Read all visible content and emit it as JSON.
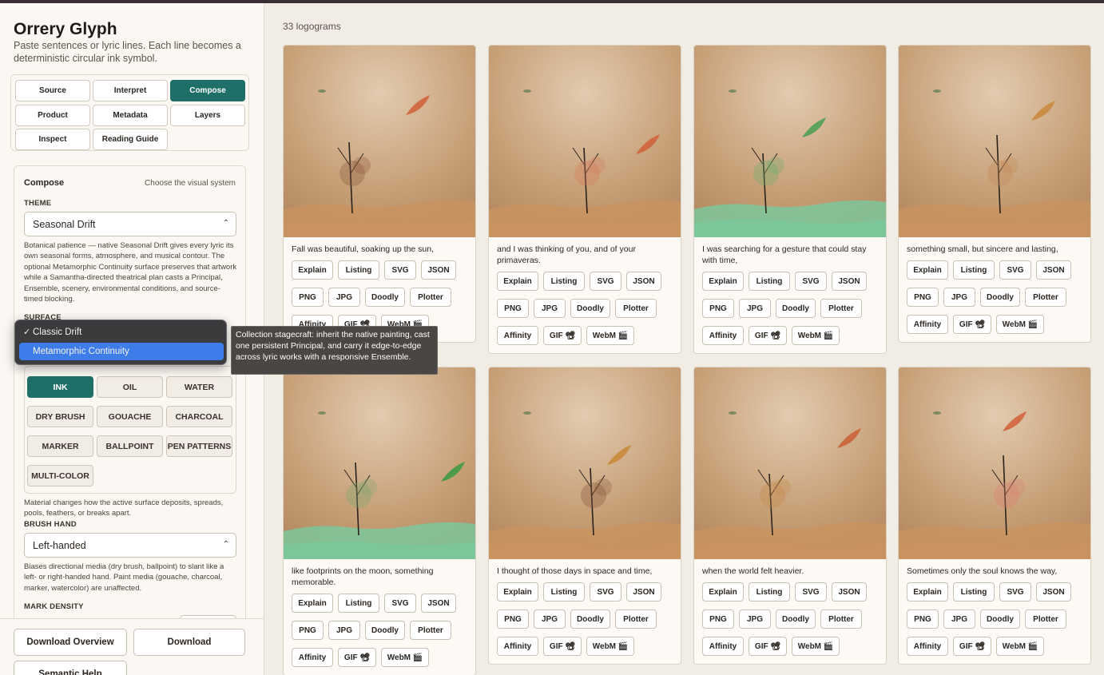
{
  "app": {
    "title": "Orrery Glyph",
    "subtitle": "Paste sentences or lyric lines. Each line becomes a deterministic circular ink symbol."
  },
  "tabs": [
    {
      "label": "Source",
      "active": false
    },
    {
      "label": "Interpret",
      "active": false
    },
    {
      "label": "Compose",
      "active": true
    },
    {
      "label": "Product",
      "active": false
    },
    {
      "label": "Metadata",
      "active": false
    },
    {
      "label": "Layers",
      "active": false
    },
    {
      "label": "Inspect",
      "active": false
    },
    {
      "label": "Reading Guide",
      "active": false
    }
  ],
  "compose": {
    "title": "Compose",
    "hint": "Choose the visual system",
    "theme_label": "THEME",
    "theme_value": "Seasonal Drift",
    "theme_desc": "Botanical patience — native Seasonal Drift gives every lyric its own seasonal forms, atmosphere, and musical contour. The optional Metamorphic Continuity surface preserves that artwork while a Samantha-directed theatrical plan casts a Principal, Ensemble, scenery, environmental conditions, and source-timed blocking.",
    "surface_label": "SURFACE",
    "surface_options": [
      {
        "label": "Classic Drift",
        "selected": true,
        "highlighted": false
      },
      {
        "label": "Metamorphic Continuity",
        "selected": false,
        "highlighted": true
      }
    ],
    "surface_tooltip": "Collection stagecraft: inherit the native painting, cast one persistent Principal, and carry it edge-to-edge across lyric works with a responsive Ensemble.",
    "materials": [
      {
        "label": "INK",
        "active": true
      },
      {
        "label": "OIL",
        "active": false
      },
      {
        "label": "WATER",
        "active": false
      },
      {
        "label": "DRY BRUSH",
        "active": false
      },
      {
        "label": "GOUACHE",
        "active": false
      },
      {
        "label": "CHARCOAL",
        "active": false
      },
      {
        "label": "MARKER",
        "active": false
      },
      {
        "label": "BALLPOINT",
        "active": false
      },
      {
        "label": "PEN PATTERNS",
        "active": false
      },
      {
        "label": "MULTI-COLOR",
        "active": false
      }
    ],
    "material_desc": "Material changes how the active surface deposits, spreads, pools, feathers, or breaks apart.",
    "brush_label": "BRUSH HAND",
    "brush_value": "Left-handed",
    "brush_desc": "Biases directional media (dry brush, ballpoint) to slant like a left- or right-handed hand. Paint media (gouache, charcoal, marker, watercolor) are unaffected.",
    "density_label": "MARK DENSITY"
  },
  "bottom": {
    "download_overview": "Download Overview",
    "download": "Download",
    "semantic_help": "Semantic Help"
  },
  "main": {
    "count_text": "33 logograms",
    "actions": [
      "Explain",
      "Listing",
      "SVG",
      "JSON",
      "PNG",
      "JPG",
      "Doodly",
      "Plotter",
      "Affinity",
      "GIF 📽",
      "WebM 🎬"
    ],
    "cards": [
      {
        "caption": "Fall was beautiful, soaking up the sun,",
        "ground": "#c8935f",
        "accent": "#d0643c",
        "fill": "#8a5a3c"
      },
      {
        "caption": "and I was thinking of you, and of your primaveras.",
        "ground": "#c8935f",
        "accent": "#d0643c",
        "fill": "#d47a5c"
      },
      {
        "caption": "I was searching for a gesture that could stay with time,",
        "ground": "#7cc79a",
        "accent": "#4f9e55",
        "fill": "#6cab6a"
      },
      {
        "caption": "something small, but sincere and lasting,",
        "ground": "#c8935f",
        "accent": "#c98a3e",
        "fill": "#c48a58"
      },
      {
        "caption": "like footprints on the moon, something memorable.",
        "ground": "#7cc79a",
        "accent": "#3f9a45",
        "fill": "#7aa66e"
      },
      {
        "caption": "I thought of those days in space and time,",
        "ground": "#c8935f",
        "accent": "#c88a3a",
        "fill": "#8a5a3c"
      },
      {
        "caption": "when the world felt heavier.",
        "ground": "#c8935f",
        "accent": "#c9643a",
        "fill": "#c48a4a"
      },
      {
        "caption": "Sometimes only the soul knows the way,",
        "ground": "#c8935f",
        "accent": "#d0643c",
        "fill": "#d98070"
      }
    ]
  },
  "colors": {
    "accent": "#1e6f67",
    "topbar": "#3a2e36",
    "parchment": "#c9a27a"
  }
}
